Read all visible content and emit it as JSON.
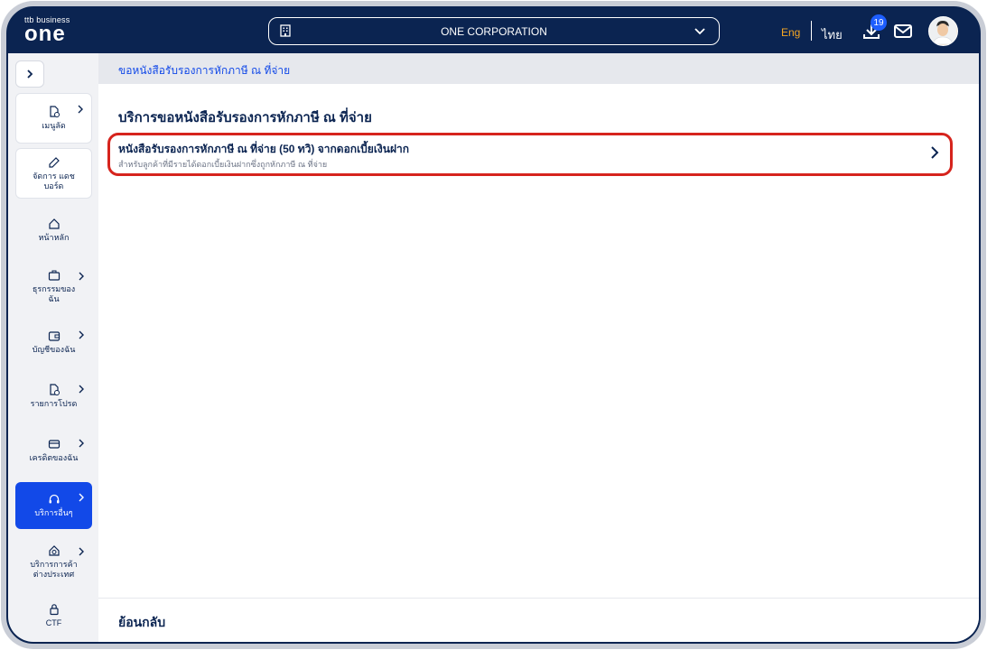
{
  "header": {
    "brand_small": "ttb business",
    "brand_word": "one",
    "company": "ONE CORPORATION",
    "lang_en": "Eng",
    "lang_th": "ไทย",
    "download_count": "19"
  },
  "sidebar": {
    "items": [
      {
        "label": "เมนูลัด"
      },
      {
        "label": "จัดการ แดชบอร์ด"
      },
      {
        "label": "หน้าหลัก"
      },
      {
        "label": "ธุรกรรมของ ฉัน"
      },
      {
        "label": "บัญชีของฉัน"
      },
      {
        "label": "รายการโปรด"
      },
      {
        "label": "เครดิตของฉัน"
      },
      {
        "label": "บริการอื่นๆ"
      },
      {
        "label": "บริการการค้า ต่างประเทศ"
      },
      {
        "label": "CTF"
      }
    ]
  },
  "main": {
    "breadcrumb": "ขอหนังสือรับรองการหักภาษี ณ ที่จ่าย",
    "title": "บริการขอหนังสือรับรองการหักภาษี ณ ที่จ่าย",
    "card_title": "หนังสือรับรองการหักภาษี ณ ที่จ่าย (50 ทวิ) จากดอกเบี้ยเงินฝาก",
    "card_sub": "สำหรับลูกค้าที่มีรายได้ดอกเบี้ยเงินฝากซึ่งถูกหักภาษี ณ ที่จ่าย",
    "back": "ย้อนกลับ"
  },
  "colors": {
    "navy": "#0b2451",
    "accent": "#1249e8",
    "highlight": "#d6241d",
    "lang_active": "#f5a623"
  }
}
